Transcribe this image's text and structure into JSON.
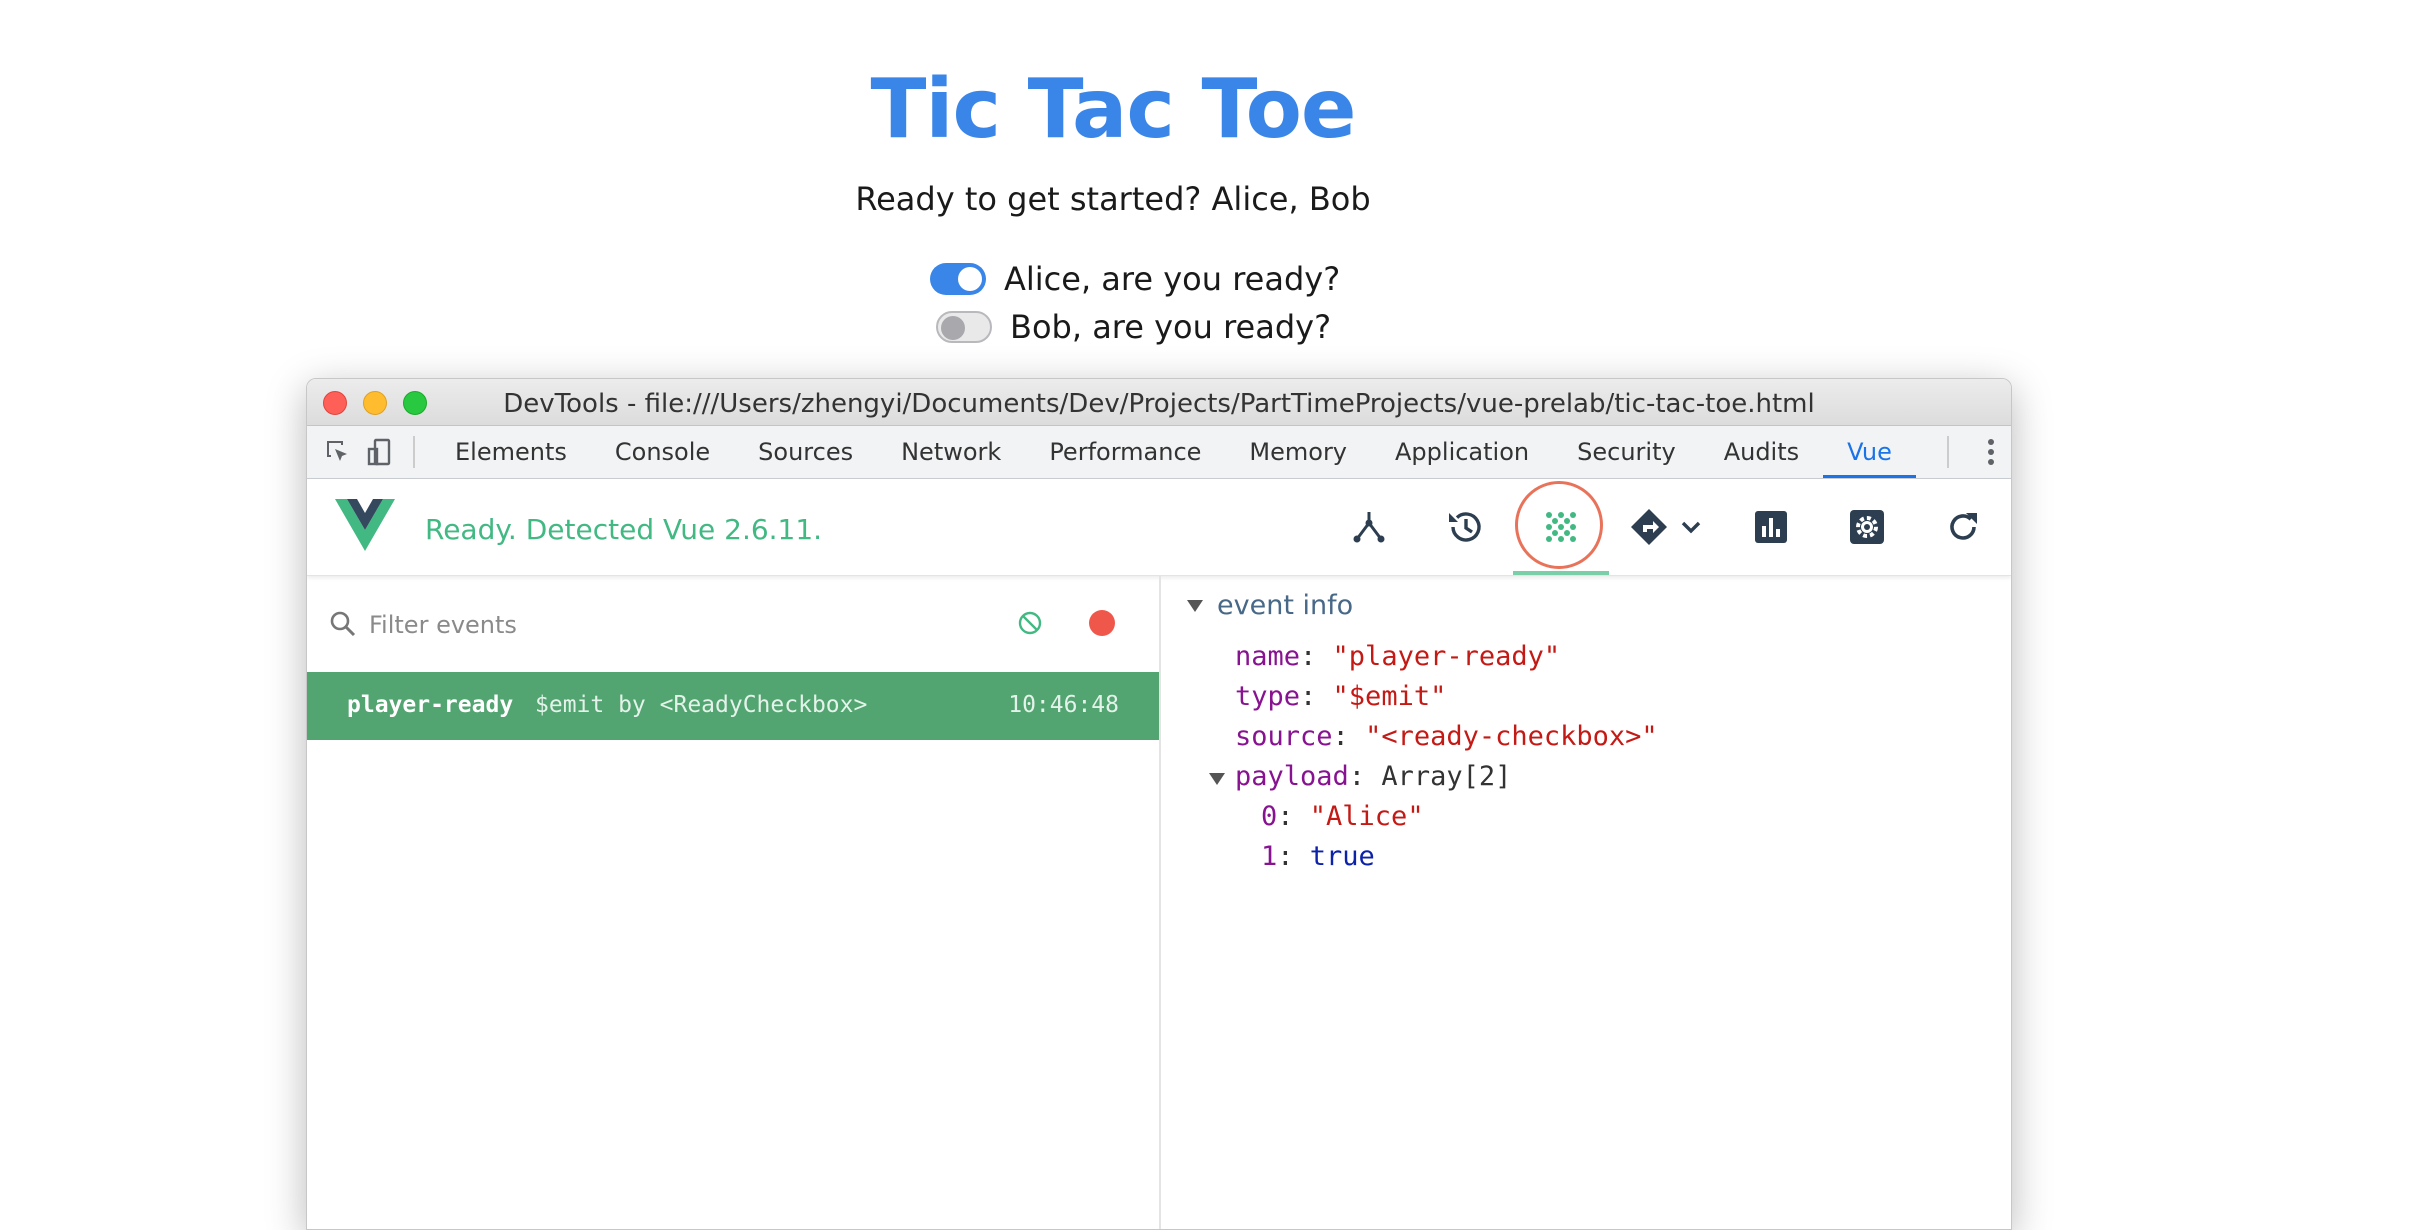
{
  "page": {
    "title": "Tic Tac Toe",
    "subtitle": "Ready to get started? Alice, Bob",
    "players": [
      {
        "label": "Alice, are you ready?",
        "ready": true
      },
      {
        "label": "Bob, are you ready?",
        "ready": false
      }
    ]
  },
  "devtools": {
    "window_title": "DevTools - file:///Users/zhengyi/Documents/Dev/Projects/PartTimeProjects/vue-prelab/tic-tac-toe.html",
    "tabs": [
      "Elements",
      "Console",
      "Sources",
      "Network",
      "Performance",
      "Memory",
      "Application",
      "Security",
      "Audits",
      "Vue"
    ],
    "active_tab": "Vue",
    "vue": {
      "status": "Ready. Detected Vue 2.6.11.",
      "brand_color": "#42b983",
      "tools": [
        "components-icon",
        "history-icon",
        "events-icon",
        "routing-icon",
        "performance-icon",
        "settings-icon",
        "refresh-icon"
      ],
      "active_tool": "events-icon"
    },
    "events": {
      "filter_placeholder": "Filter events",
      "list": [
        {
          "name": "player-ready",
          "meta": "$emit by <ReadyCheckbox>",
          "time": "10:46:48",
          "selected": true
        }
      ]
    },
    "event_info": {
      "heading": "event info",
      "name_key": "name",
      "name_value": "\"player-ready\"",
      "type_key": "type",
      "type_value": "\"$emit\"",
      "source_key": "source",
      "source_value": "\"<ready-checkbox>\"",
      "payload_key": "payload",
      "payload_type": "Array[2]",
      "payload": [
        {
          "index": "0",
          "value": "\"Alice\""
        },
        {
          "index": "1",
          "value": "true"
        }
      ]
    }
  }
}
